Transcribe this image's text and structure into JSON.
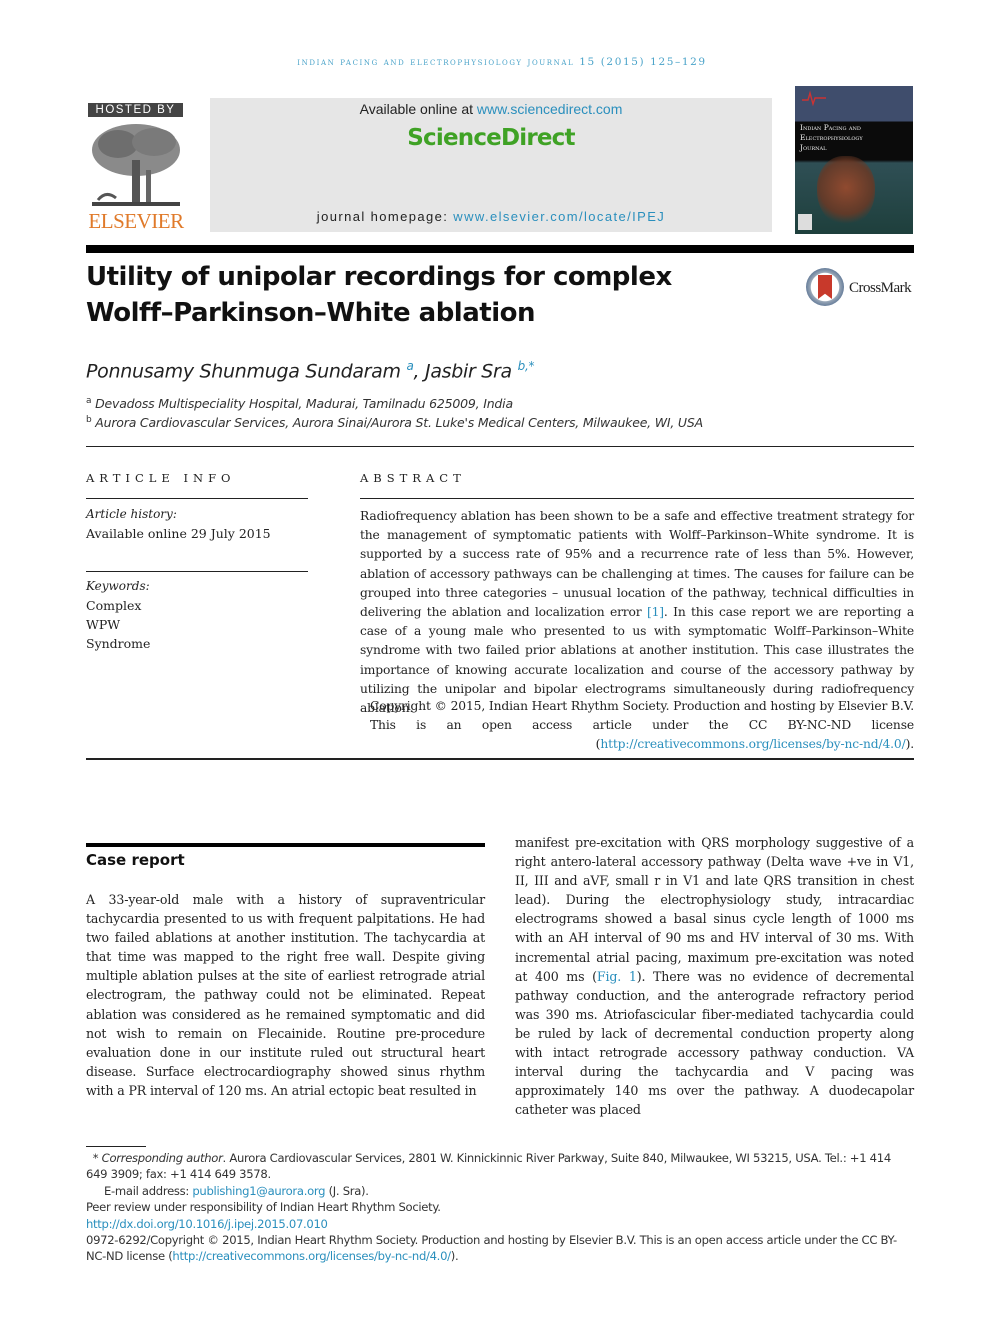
{
  "running_head": "Indian Pacing and Electrophysiology Journal 15 (2015) 125–129",
  "publisher": {
    "hosted_by": "HOSTED BY",
    "logo_word": "ELSEVIER"
  },
  "banner": {
    "available_prefix": "Available online at ",
    "available_link": "www.sciencedirect.com",
    "brand": "ScienceDirect",
    "homepage_prefix": "journal homepage: ",
    "homepage_link": "www.elsevier.com/locate/IPEJ"
  },
  "cover": {
    "title_line1": "Indian Pacing and",
    "title_line2": "Electrophysiology",
    "title_line3": "Journal"
  },
  "crossmark": {
    "label": "CrossMark"
  },
  "article": {
    "title_line1": "Utility of unipolar recordings for complex",
    "title_line2": "Wolff–Parkinson–White ablation",
    "authors": [
      {
        "name": "Ponnusamy Shunmuga Sundaram",
        "sup": "a"
      },
      {
        "name": "Jasbir Sra",
        "sup": "b,*"
      }
    ],
    "affiliations": [
      {
        "mark": "a",
        "text": "Devadoss Multispeciality Hospital, Madurai, Tamilnadu 625009, India"
      },
      {
        "mark": "b",
        "text": "Aurora Cardiovascular Services, Aurora Sinai/Aurora St. Luke's Medical Centers, Milwaukee, WI, USA"
      }
    ]
  },
  "article_info": {
    "heading": "ARTICLE INFO",
    "history_label": "Article history:",
    "history_value": "Available online 29 July 2015",
    "keywords_label": "Keywords:",
    "keywords": [
      "Complex",
      "WPW",
      "Syndrome"
    ]
  },
  "abstract": {
    "heading": "ABSTRACT",
    "text_part1": "Radiofrequency ablation has been shown to be a safe and effective treatment strategy for the management of symptomatic patients with Wolff–Parkinson–White syndrome. It is supported by a success rate of 95% and a recurrence rate of less than 5%. However, ablation of accessory pathways can be challenging at times. The causes for failure can be grouped into three categories – unusual location of the pathway, technical difficulties in delivering the ablation and localization error ",
    "ref": "[1]",
    "text_part2": ". In this case report we are reporting a case of a young male who presented to us with symptomatic Wolff–Parkinson–White syndrome with two failed prior ablations at another institution. This case illustrates the importance of knowing accurate localization and course of the accessory pathway by utilizing the unipolar and bipolar electrograms simultaneously during radiofrequency ablation.",
    "copyright_text": "Copyright © 2015, Indian Heart Rhythm Society. Production and hosting by Elsevier B.V. This is an open access article under the CC BY-NC-ND license (",
    "license_link": "http://creativecommons.org/licenses/by-nc-nd/4.0/",
    "copyright_end": ")."
  },
  "case_report": {
    "heading": "Case report",
    "left_text": "A 33-year-old male with a history of supraventricular tachycardia presented to us with frequent palpitations. He had two failed ablations at another institution. The tachycardia at that time was mapped to the right free wall. Despite giving multiple ablation pulses at the site of earliest retrograde atrial electrogram, the pathway could not be eliminated. Repeat ablation was considered as he remained symptomatic and did not wish to remain on Flecainide. Routine pre-procedure evaluation done in our institute ruled out structural heart disease. Surface electrocardiography showed sinus rhythm with a PR interval of 120 ms. An atrial ectopic beat resulted in",
    "right_text_part1": "manifest pre-excitation with QRS morphology suggestive of a right antero-lateral accessory pathway (Delta wave +ve in V1, II, III and aVF, small r in V1 and late QRS transition in chest lead). During the electrophysiology study, intracardiac electrograms showed a basal sinus cycle length of 1000 ms with an AH interval of 90 ms and HV interval of 30 ms. With incremental atrial pacing, maximum pre-excitation was noted at 400 ms (",
    "fig_ref": "Fig. 1",
    "right_text_part2": "). There was no evidence of decremental pathway conduction, and the anterograde refractory period was 390 ms. Atriofascicular fiber-mediated tachycardia could be ruled by lack of decremental conduction property along with intact retrograde accessory pathway conduction. VA interval during the tachycardia and V pacing was approximately 140 ms over the pathway. A duodecapolar catheter was placed"
  },
  "footnotes": {
    "corresponding_mark": "*",
    "corresponding_label": "Corresponding author",
    "corresponding_text": ". Aurora Cardiovascular Services, 2801 W. Kinnickinnic River Parkway, Suite 840, Milwaukee, WI 53215, USA. Tel.: +1 414 649 3909; fax: +1 414 649 3578.",
    "email_label": "E-mail address: ",
    "email": "publishing1@aurora.org",
    "email_suffix": " (J. Sra).",
    "peer_review": "Peer review under responsibility of Indian Heart Rhythm Society.",
    "doi": "http://dx.doi.org/10.1016/j.ipej.2015.07.010",
    "issn_text": "0972-6292/Copyright © 2015, Indian Heart Rhythm Society. Production and hosting by Elsevier B.V. This is an open access article under the CC BY-NC-ND license (",
    "issn_link": "http://creativecommons.org/licenses/by-nc-nd/4.0/",
    "issn_end": ")."
  }
}
